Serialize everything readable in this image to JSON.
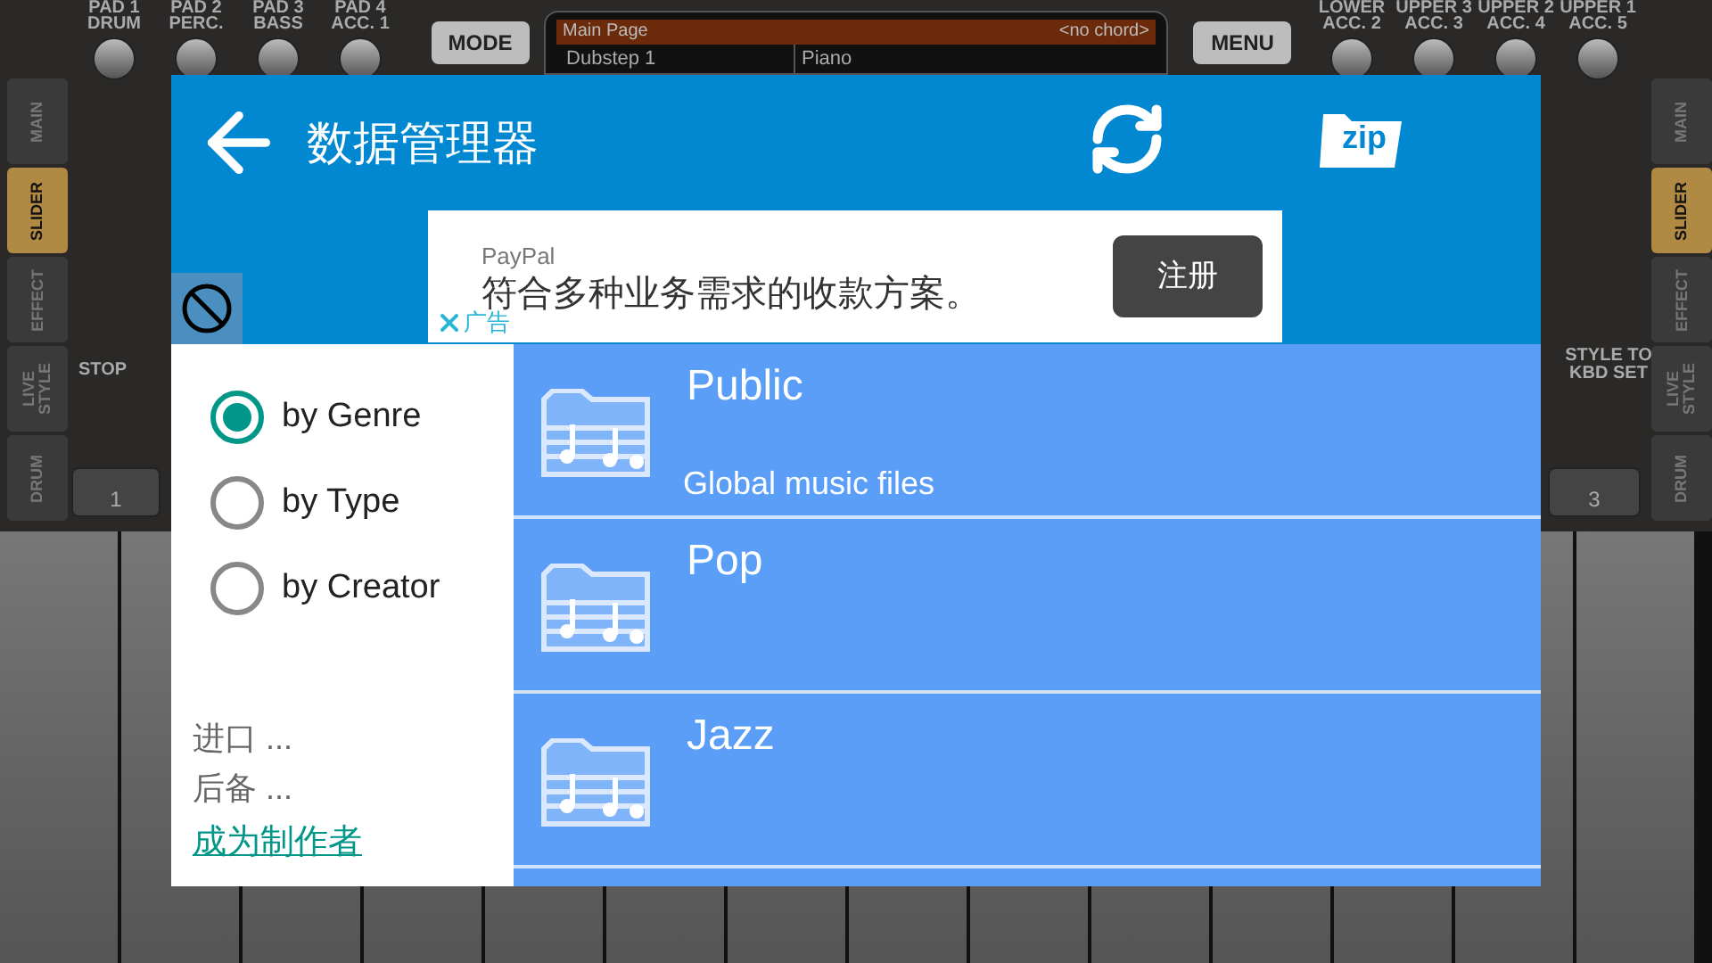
{
  "background": {
    "pads_left": [
      {
        "line1": "PAD 1",
        "line2": "DRUM"
      },
      {
        "line1": "PAD 2",
        "line2": "PERC."
      },
      {
        "line1": "PAD 3",
        "line2": "BASS"
      },
      {
        "line1": "PAD 4",
        "line2": "ACC. 1"
      }
    ],
    "mode_button": "MODE",
    "display": {
      "title": "Main Page",
      "chord": "<no chord>",
      "style": "Dubstep 1",
      "voice": "Piano"
    },
    "menu_button": "MENU",
    "pads_right": [
      {
        "line1": "LOWER",
        "line2": "ACC. 2"
      },
      {
        "line1": "UPPER 3",
        "line2": "ACC. 3"
      },
      {
        "line1": "UPPER 2",
        "line2": "ACC. 4"
      },
      {
        "line1": "UPPER 1",
        "line2": "ACC. 5"
      }
    ],
    "left_tabs": [
      {
        "label": "MAIN",
        "selected": false
      },
      {
        "label": "SLIDER",
        "selected": true
      },
      {
        "label": "EFFECT",
        "selected": false
      },
      {
        "label": "LIVE STYLE",
        "selected": false
      },
      {
        "label": "DRUM",
        "selected": false
      }
    ],
    "right_tabs": [
      {
        "label": "MAIN",
        "selected": false
      },
      {
        "label": "SLIDER",
        "selected": true
      },
      {
        "label": "EFFECT",
        "selected": false
      },
      {
        "label": "LIVE STYLE",
        "selected": false
      },
      {
        "label": "DRUM",
        "selected": false
      }
    ],
    "stop_label": "STOP",
    "style_to_kbd_label": "STYLE TO KBD SET",
    "left_slot": "1",
    "right_slot": "3"
  },
  "dialog": {
    "title": "数据管理器",
    "zip_label": "zip",
    "ad": {
      "brand": "PayPal",
      "text": "符合多种业务需求的收款方案。",
      "button": "注册",
      "close_label": "广告"
    },
    "filters": [
      {
        "label": "by Genre",
        "selected": true
      },
      {
        "label": "by Type",
        "selected": false
      },
      {
        "label": "by Creator",
        "selected": false
      }
    ],
    "actions": [
      {
        "label": "进口 ...",
        "kind": "menu"
      },
      {
        "label": "后备 ...",
        "kind": "menu"
      },
      {
        "label": "成为制作者",
        "kind": "link"
      }
    ],
    "folders": [
      {
        "name": "Public",
        "description": "Global music files"
      },
      {
        "name": "Pop"
      },
      {
        "name": "Jazz"
      }
    ]
  }
}
